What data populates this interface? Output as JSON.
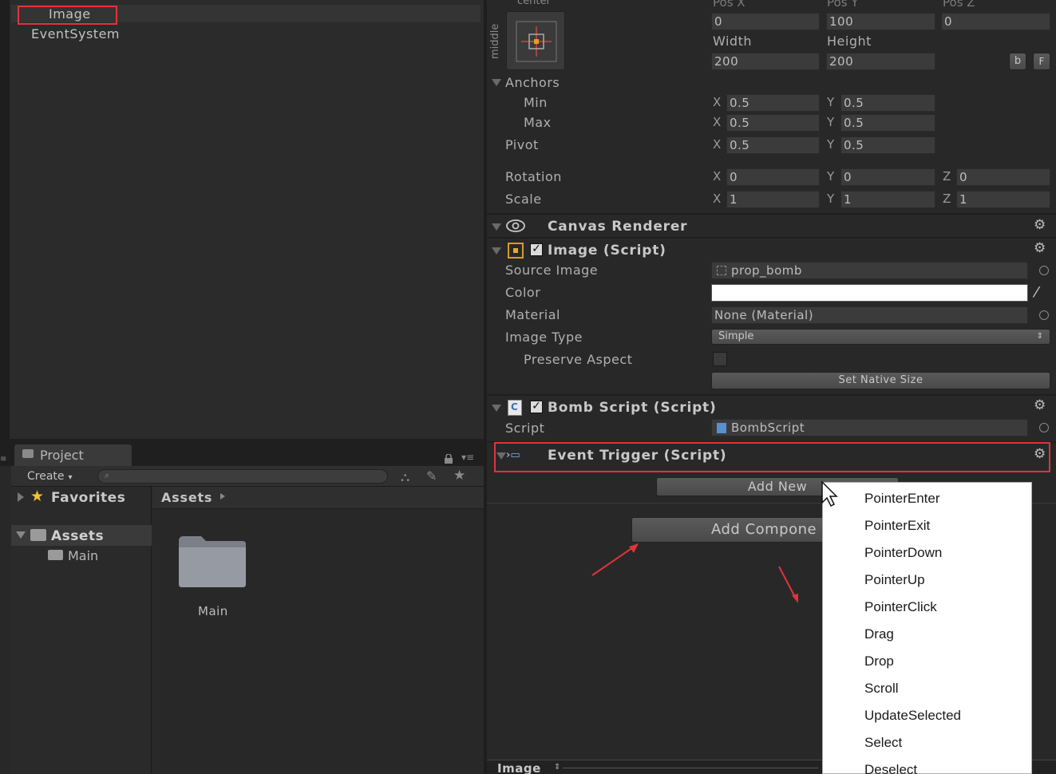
{
  "hierarchy": {
    "items": [
      {
        "label": "Image"
      },
      {
        "label": "EventSystem"
      }
    ]
  },
  "project": {
    "tab_label": "Project",
    "create_label": "Create",
    "sidebar": {
      "favorites_label": "Favorites",
      "assets_label": "Assets",
      "main_label": "Main"
    },
    "breadcrumb": "Assets",
    "folder_label": "Main"
  },
  "inspector": {
    "rect_transform": {
      "anchor_preset_top": "center",
      "anchor_preset_side": "middle",
      "pos_x_label": "Pos X",
      "pos_y_label": "Pos Y",
      "pos_z_label": "Pos Z",
      "pos_x": "0",
      "pos_y": "100",
      "pos_z": "0",
      "width_label": "Width",
      "height_label": "Height",
      "width": "200",
      "height": "200",
      "blueprint_btn": "b",
      "raw_btn": "F",
      "anchors_label": "Anchors",
      "min_label": "Min",
      "max_label": "Max",
      "pivot_label": "Pivot",
      "rotation_label": "Rotation",
      "scale_label": "Scale",
      "x_axis": "X",
      "y_axis": "Y",
      "z_axis": "Z",
      "anchor_min_x": "0.5",
      "anchor_min_y": "0.5",
      "anchor_max_x": "0.5",
      "anchor_max_y": "0.5",
      "pivot_x": "0.5",
      "pivot_y": "0.5",
      "rotation_x": "0",
      "rotation_y": "0",
      "rotation_z": "0",
      "scale_x": "1",
      "scale_y": "1",
      "scale_z": "1"
    },
    "canvas_renderer": {
      "title": "Canvas Renderer"
    },
    "image": {
      "title": "Image (Script)",
      "source_image_label": "Source Image",
      "source_image_value": "prop_bomb",
      "color_label": "Color",
      "color_value": "#ffffff",
      "material_label": "Material",
      "material_value": "None (Material)",
      "image_type_label": "Image Type",
      "image_type_value": "Simple",
      "preserve_aspect_label": "Preserve Aspect",
      "set_native_size_label": "Set Native Size"
    },
    "bomb_script": {
      "title": "Bomb Script (Script)",
      "script_label": "Script",
      "script_value": "BombScript"
    },
    "event_trigger": {
      "title": "Event Trigger (Script)",
      "add_new_label": "Add New"
    },
    "add_component_label": "Add Compone",
    "footer_label": "Image"
  },
  "dropdown": {
    "items": [
      "PointerEnter",
      "PointerExit",
      "PointerDown",
      "PointerUp",
      "PointerClick",
      "Drag",
      "Drop",
      "Scroll",
      "UpdateSelected",
      "Select",
      "Deselect"
    ]
  },
  "colors": {
    "highlight_red": "#e0343a",
    "panel_dark": "#282828"
  }
}
